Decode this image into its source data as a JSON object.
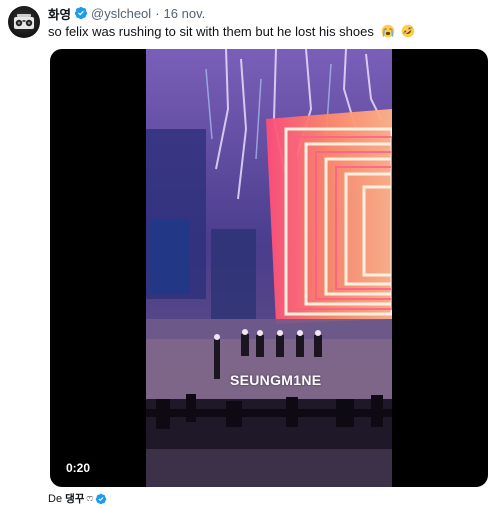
{
  "tweet": {
    "author_name": "화영",
    "author_handle": "@yslcheol",
    "separator": "·",
    "date": "16 nov.",
    "text": "so felix was rushing to sit with them but he lost his shoes",
    "emojis": [
      "loudly-crying-face-icon",
      "rolling-on-floor-laughing-icon"
    ]
  },
  "media": {
    "duration": "0:20",
    "watermark": "SEUNGM1NE"
  },
  "footer": {
    "prefix": "De",
    "name": "댕꾸",
    "small_symbol": "ෆ"
  },
  "colors": {
    "verified_blue": "#1d9bf0",
    "secondary_text": "#536471",
    "primary_text": "#0f1419"
  }
}
